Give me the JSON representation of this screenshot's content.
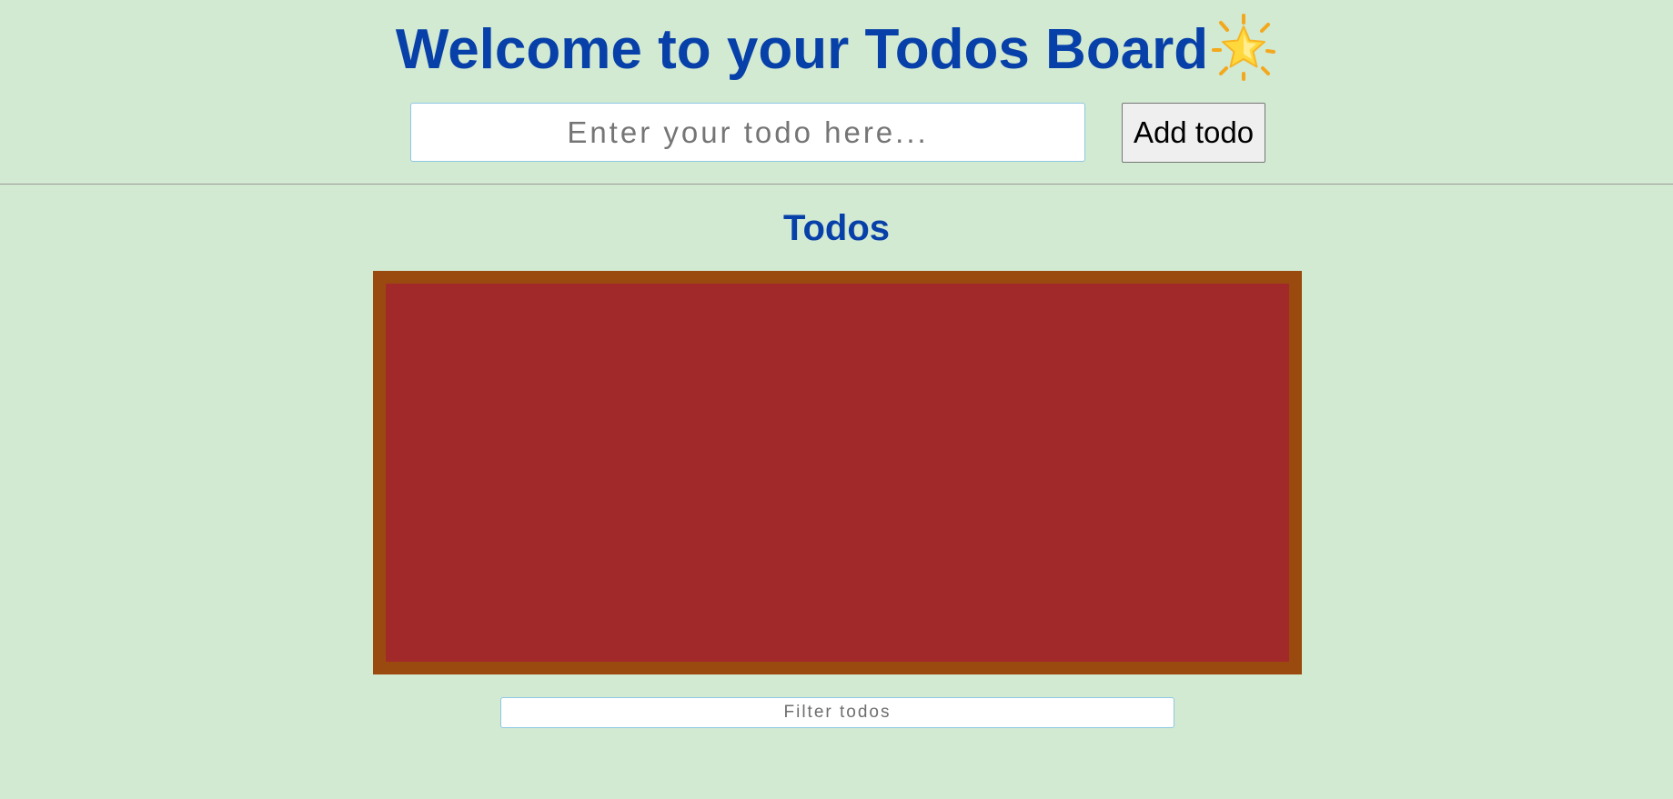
{
  "header": {
    "title": "Welcome to your Todos Board",
    "title_icon": "glowing-star-icon",
    "title_color": "#0640a8"
  },
  "new_todo": {
    "placeholder": "Enter your todo here...",
    "value": "",
    "add_button_label": "Add todo"
  },
  "todos_section": {
    "title": "Todos",
    "items": [],
    "board_color": "#a2292a",
    "board_border_color": "#9a4a0e"
  },
  "filter": {
    "placeholder": "Filter todos",
    "value": ""
  },
  "colors": {
    "background": "#d2e9d2",
    "input_border": "#8ec8e2"
  }
}
